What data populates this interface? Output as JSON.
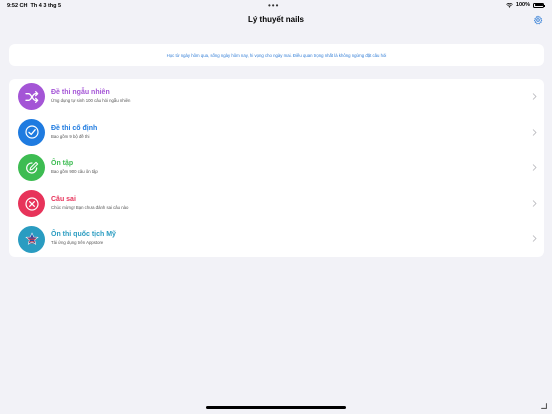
{
  "status": {
    "time": "9:52 CH",
    "date": "Th 4 3 thg 5",
    "battery": "100%",
    "battery_level": 1.0
  },
  "nav": {
    "title": "Lý thuyết nails"
  },
  "banner": {
    "text": "Học từ ngày hôm qua, sống ngày hôm nay, hi vọng cho ngày mai. Điều quan trọng nhất là không ngừng đặt câu hỏi"
  },
  "menu": {
    "items": [
      {
        "title": "Đề thi ngẫu nhiên",
        "subtitle": "Ứng dụng tự sinh 100 câu hỏi ngẫu nhiên",
        "icon": "shuffle-icon",
        "color": "#a455d6"
      },
      {
        "title": "Đề thi cố định",
        "subtitle": "Bao gồm 9 bộ đề thi",
        "icon": "checkmark-icon",
        "color": "#1f7be0"
      },
      {
        "title": "Ôn tập",
        "subtitle": "Bao gồm 900 câu ôn tập",
        "icon": "edit-icon",
        "color": "#3dbc52"
      },
      {
        "title": "Câu sai",
        "subtitle": "Chúc mừng! Bạn chưa đánh sai câu nào",
        "icon": "x-mark-icon",
        "color": "#e7335a"
      },
      {
        "title": "Ôn thi quốc tịch Mỹ",
        "subtitle": "Tải ứng dụng trên Appstore",
        "icon": "us-flag-icon",
        "color": "#2a9cc1"
      }
    ]
  },
  "colors": {
    "background": "#f2f2f7",
    "accent": "#2f7cd6"
  }
}
